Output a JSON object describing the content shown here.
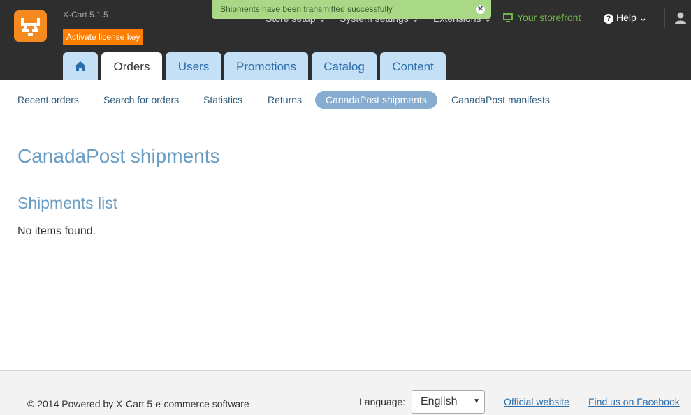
{
  "header": {
    "version": "X-Cart 5.1.5",
    "license_button": "Activate license key",
    "top_menu": [
      "Store setup",
      "System settings",
      "Extensions"
    ],
    "storefront": "Your storefront",
    "help": "Help"
  },
  "notification": {
    "text": "Shipments have been transmitted successfully",
    "close_glyph": "✕"
  },
  "tabs": {
    "home_icon": "home-icon",
    "items": [
      "Orders",
      "Users",
      "Promotions",
      "Catalog",
      "Content"
    ],
    "active": "Orders"
  },
  "subnav": {
    "items": [
      "Recent orders",
      "Search for orders",
      "Statistics",
      "Returns",
      "CanadaPost shipments",
      "CanadaPost manifests"
    ],
    "active": "CanadaPost shipments"
  },
  "main": {
    "title": "CanadaPost shipments",
    "section_title": "Shipments list",
    "empty_text": "No items found."
  },
  "footer": {
    "copyright": "© 2014 Powered by X-Cart 5 e-commerce software",
    "language_label": "Language:",
    "language_value": "English",
    "official_link": "Official website",
    "facebook_link": "Find us on Facebook"
  },
  "colors": {
    "header_bg": "#2e2e2e",
    "accent_orange": "#ff7e00",
    "tab_bg": "#c4e0f7",
    "notice_bg": "#a9d886",
    "title_blue": "#6a9dc3",
    "storefront_green": "#6fb64d"
  }
}
